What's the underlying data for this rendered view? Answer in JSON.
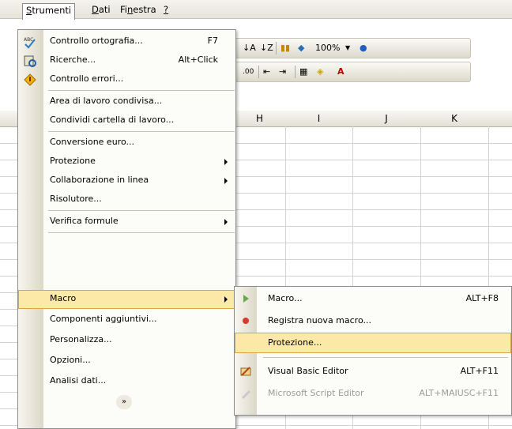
{
  "menubar": {
    "items": [
      "Strumenti",
      "Dati",
      "Finestra",
      "?"
    ]
  },
  "toolbar1": {
    "zoom": "100%"
  },
  "columns": [
    "H",
    "I",
    "J",
    "K"
  ],
  "tools_menu": {
    "items": [
      {
        "label": "Controllo ortografia...",
        "shortcut": "F7",
        "icon": "spellcheck-icon"
      },
      {
        "label": "Ricerche...",
        "shortcut": "Alt+Click",
        "icon": "research-icon"
      },
      {
        "label": "Controllo errori...",
        "icon": "error-check-icon"
      },
      {
        "label": "Area di lavoro condivisa..."
      },
      {
        "label": "Condividi cartella di lavoro..."
      },
      {
        "label": "Conversione euro..."
      },
      {
        "label": "Protezione",
        "submenu": true
      },
      {
        "label": "Collaborazione in linea",
        "submenu": true
      },
      {
        "label": "Risolutore..."
      },
      {
        "label": "Verifica formule",
        "submenu": true
      },
      {
        "label": "Macro",
        "submenu": true,
        "highlighted": true
      },
      {
        "label": "Componenti aggiuntivi..."
      },
      {
        "label": "Personalizza..."
      },
      {
        "label": "Opzioni..."
      },
      {
        "label": "Analisi dati..."
      }
    ],
    "expand_icon": "chevron-double-down-icon"
  },
  "macro_submenu": {
    "items": [
      {
        "label": "Macro...",
        "shortcut": "ALT+F8",
        "icon": "play-icon"
      },
      {
        "label": "Registra nuova macro...",
        "icon": "record-icon"
      },
      {
        "label": "Protezione...",
        "highlighted": true
      },
      {
        "label": "Visual Basic Editor",
        "shortcut": "ALT+F11",
        "icon": "vb-editor-icon"
      },
      {
        "label": "Microsoft Script Editor",
        "shortcut": "ALT+MAIUSC+F11",
        "icon": "script-editor-icon",
        "disabled": true
      }
    ]
  },
  "colors": {
    "highlight": "#fce9a8",
    "highlight_border": "#d6a64a"
  }
}
